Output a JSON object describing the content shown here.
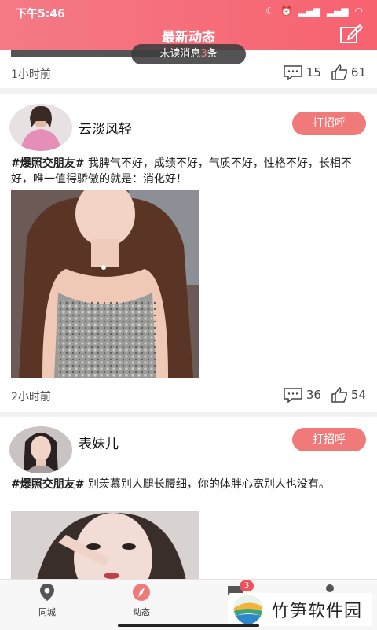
{
  "status_bar": {
    "time": "下午5:46"
  },
  "header": {
    "title": "最新动态"
  },
  "unread_toast": {
    "prefix": "未读消息",
    "count": "3",
    "suffix": "条"
  },
  "posts": [
    {
      "time": "1小时前",
      "comments": "15",
      "likes": "61"
    },
    {
      "name": "云淡风轻",
      "greet": "打招呼",
      "tag": "#爆照交朋友#",
      "text": " 我脾气不好，成绩不好，气质不好，性格不好，长相不好，唯一值得骄傲的就是：消化好！",
      "time": "2小时前",
      "comments": "36",
      "likes": "54"
    },
    {
      "name": "表妹儿",
      "greet": "打招呼",
      "tag": "#爆照交朋友#",
      "text": " 别羡慕别人腿长腰细，你的体胖心宽别人也没有。"
    }
  ],
  "tabbar": {
    "items": [
      {
        "label": "同城"
      },
      {
        "label": "动态"
      }
    ],
    "badge": "3"
  },
  "watermark": {
    "text": "竹笋软件园"
  },
  "colors": {
    "accent": "#f47a86",
    "button": "#f07a7a"
  }
}
